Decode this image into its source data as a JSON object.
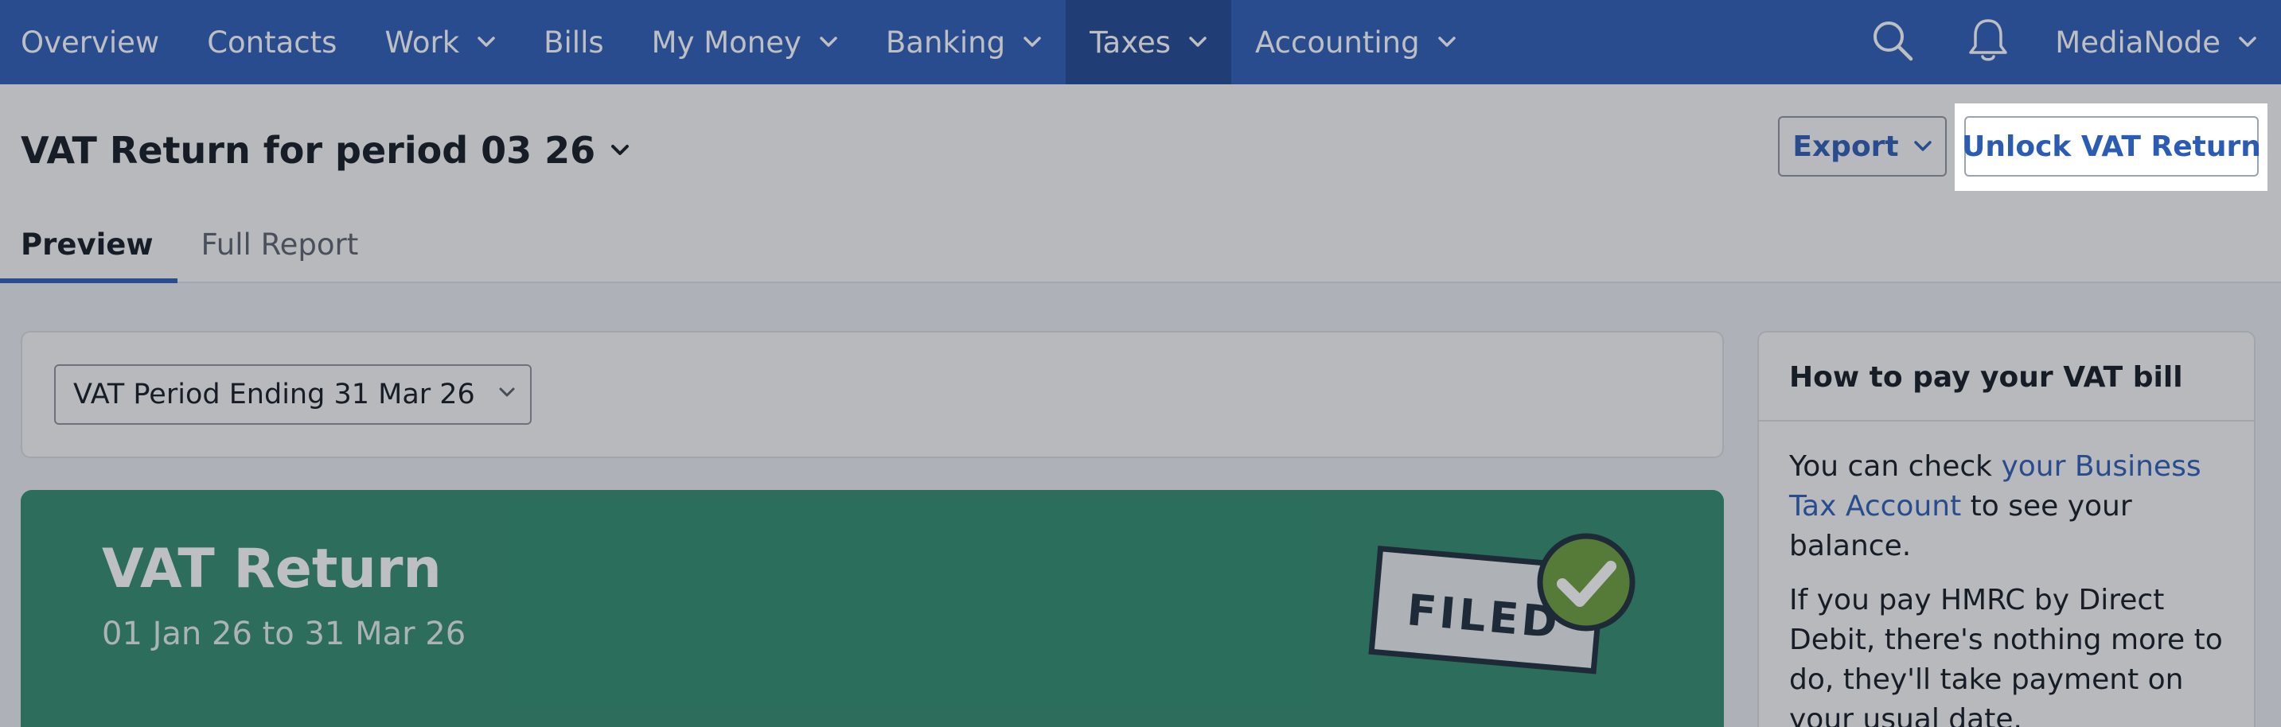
{
  "nav": {
    "items": [
      {
        "label": "Overview",
        "dropdown": false,
        "active": false
      },
      {
        "label": "Contacts",
        "dropdown": false,
        "active": false
      },
      {
        "label": "Work",
        "dropdown": true,
        "active": false
      },
      {
        "label": "Bills",
        "dropdown": false,
        "active": false
      },
      {
        "label": "My Money",
        "dropdown": true,
        "active": false
      },
      {
        "label": "Banking",
        "dropdown": true,
        "active": false
      },
      {
        "label": "Taxes",
        "dropdown": true,
        "active": true
      },
      {
        "label": "Accounting",
        "dropdown": true,
        "active": false
      }
    ],
    "org_name": "MediaNode",
    "icons": [
      "search-icon",
      "bell-icon"
    ]
  },
  "header": {
    "title": "VAT Return for period 03 26",
    "export_label": "Export",
    "unlock_label": "Unlock VAT Return",
    "tabs": [
      {
        "label": "Preview",
        "active": true
      },
      {
        "label": "Full Report",
        "active": false
      }
    ]
  },
  "period": {
    "selected": "VAT Period Ending 31 Mar 26"
  },
  "vat_card": {
    "title": "VAT Return",
    "date_range": "01 Jan 26 to 31 Mar 26",
    "stamp_text": "FILED"
  },
  "sidebar": {
    "heading": "How to pay your VAT bill",
    "p1_before": "You can check ",
    "p1_link": "your Business Tax Account",
    "p1_after": " to see your balance.",
    "p2": "If you pay HMRC by Direct Debit, there's nothing more to do, they'll take payment on your usual date."
  },
  "colors": {
    "nav_bg": "#2a5bb5",
    "nav_active_bg": "#1d4791",
    "vat_card_bg": "#2e8a6e",
    "link": "#2a5bb5",
    "stamp_check": "#6b9e3a"
  }
}
